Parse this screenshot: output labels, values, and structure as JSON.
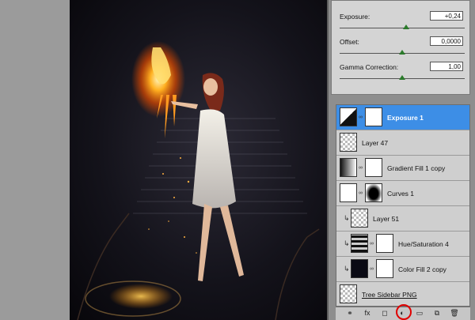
{
  "adjustments": {
    "exposure": {
      "label": "Exposure:",
      "value": "+0,24",
      "level": 0.53
    },
    "offset": {
      "label": "Offset:",
      "value": "0,0000",
      "level": 0.5
    },
    "gamma": {
      "label": "Gamma Correction:",
      "value": "1,00",
      "level": 0.5
    }
  },
  "layers": [
    {
      "name": "Exposure 1",
      "selected": true,
      "icon": "exposure-adjustment-icon",
      "mask": "white"
    },
    {
      "name": "Layer 47",
      "selected": false,
      "icon": "layer-thumbnail",
      "mask": "none"
    },
    {
      "name": "Gradient Fill 1 copy",
      "selected": false,
      "icon": "gradient-fill-icon",
      "mask": "white"
    },
    {
      "name": "Curves 1",
      "selected": false,
      "icon": "curves-icon",
      "mask": "black-blob"
    },
    {
      "name": "Layer 51",
      "selected": false,
      "icon": "layer-thumbnail",
      "mask": "none",
      "clipped": true
    },
    {
      "name": "Hue/Saturation 4",
      "selected": false,
      "icon": "hue-saturation-icon",
      "mask": "white",
      "clipped": true
    },
    {
      "name": "Color Fill 2 copy",
      "selected": false,
      "icon": "color-fill-icon",
      "mask": "white",
      "clipped": true
    },
    {
      "name": "Tree Sidebar PNG",
      "selected": false,
      "icon": "layer-thumbnail",
      "mask": "none"
    }
  ],
  "bottom_bar_icons": [
    "link-layers-icon",
    "fx-icon",
    "add-mask-icon",
    "new-adjustment-layer-icon",
    "new-group-icon",
    "new-layer-icon",
    "trash-icon"
  ],
  "bottom_bar_glyphs": [
    "⚭",
    "fx",
    "◻",
    "◐",
    "▭",
    "⧉",
    "🗑"
  ],
  "colors": {
    "selection": "#3d8ee6",
    "highlight_circle": "#e00000",
    "slider_thumb": "#2b7a2b"
  }
}
